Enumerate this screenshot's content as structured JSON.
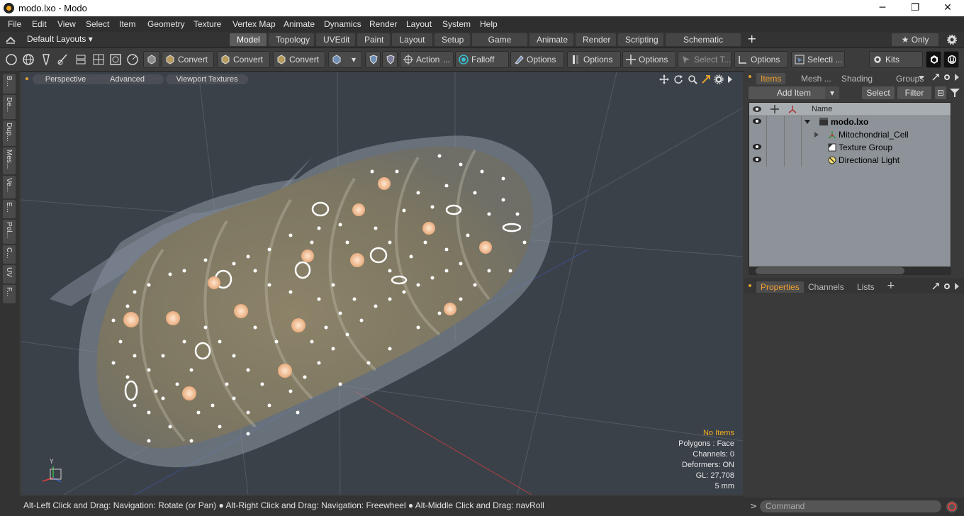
{
  "window": {
    "title": "modo.lxo - Modo",
    "minimize": "─",
    "maximize": "❐",
    "close": "✕"
  },
  "menu": [
    "File",
    "Edit",
    "View",
    "Select",
    "Item",
    "Geometry",
    "Texture",
    "Vertex Map",
    "Animate",
    "Dynamics",
    "Render",
    "Layout",
    "System",
    "Help"
  ],
  "layouts": {
    "selector": "Default Layouts ▾",
    "tabs": [
      "Model",
      "Topology",
      "UVEdit",
      "Paint",
      "Layout",
      "Setup",
      "Game Tools",
      "Animate",
      "Render",
      "Scripting",
      "Schematic Fusion"
    ],
    "active": "Model",
    "add": "+",
    "only": "★  Only"
  },
  "toolbar": {
    "convert1": "Convert",
    "convert2": "Convert",
    "convert3": "Convert",
    "action": "Action",
    "action_more": "...",
    "falloff": "Falloff",
    "options1": "Options",
    "options2": "Options",
    "options3": "Options",
    "select_t": "Select T...",
    "options4": "Options",
    "selecti": "Selecti ...",
    "kits": "Kits"
  },
  "left_tabs": [
    "B...",
    "De...",
    "Dup...",
    "Mes...",
    "Ve...",
    "E...",
    "Pol...",
    "C...",
    "UV",
    "F..."
  ],
  "viewport": {
    "tabs": [
      "Perspective",
      "Advanced",
      "Viewport Textures"
    ],
    "info": {
      "selection": "No Items",
      "polygons": "Polygons : Face",
      "channels": "Channels: 0",
      "deformers": "Deformers: ON",
      "gl": "GL: 27,708",
      "scale": "5 mm"
    },
    "axis_y": "Y"
  },
  "status": "Alt-Left Click and Drag: Navigation: Rotate (or Pan) ● Alt-Right Click and Drag: Navigation: Freewheel ● Alt-Middle Click and Drag: navRoll",
  "items_panel": {
    "tabs": [
      "Items",
      "Mesh ...",
      "Shading",
      "Groups"
    ],
    "active": "Items",
    "add_item": "Add Item",
    "select": "Select",
    "filter": "Filter",
    "column_name": "Name",
    "rows": [
      {
        "name": "modo.lxo",
        "eye": true
      },
      {
        "name": "Mitochondrial_Cell",
        "eye": false
      },
      {
        "name": "Texture Group",
        "eye": true
      },
      {
        "name": "Directional Light",
        "eye": true
      }
    ]
  },
  "properties_panel": {
    "tabs": [
      "Properties",
      "Channels",
      "Lists"
    ],
    "active": "Properties",
    "add": "+"
  },
  "command": {
    "placeholder": "Command",
    "prompt": ">"
  }
}
